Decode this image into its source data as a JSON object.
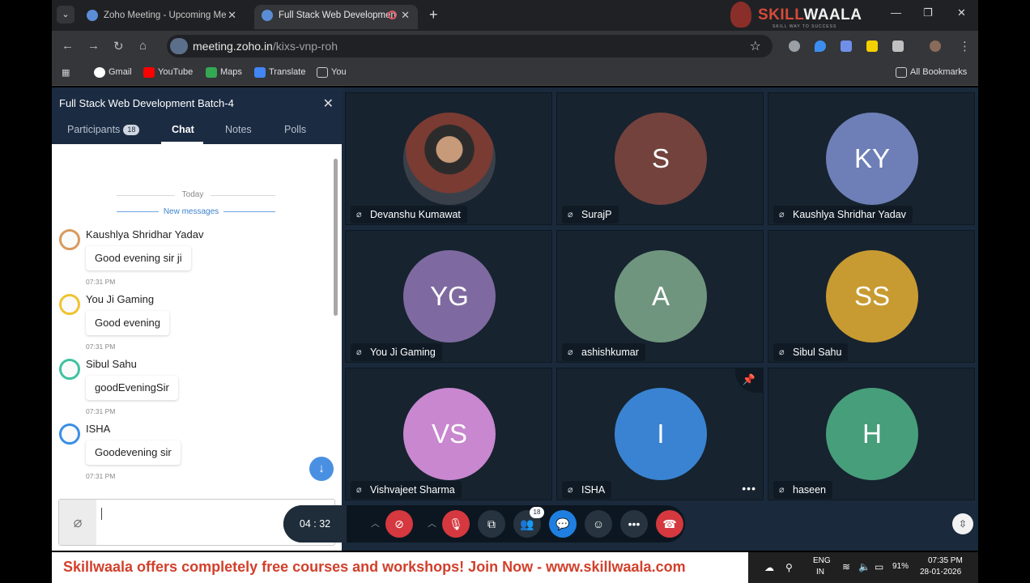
{
  "browser": {
    "tabs": [
      {
        "title": "Zoho Meeting - Upcoming Me",
        "active": false
      },
      {
        "title": "Full Stack Web Developmen",
        "active": true
      }
    ],
    "url_host": "meeting.zoho.in",
    "url_path": "/kixs-vnp-roh",
    "bookmarks": [
      "Gmail",
      "YouTube",
      "Maps",
      "Translate",
      "You"
    ],
    "all_bookmarks": "All Bookmarks",
    "brand": "SKILLWAALA"
  },
  "panel": {
    "title": "Full Stack Web Development Batch-4",
    "tabs": [
      "Participants",
      "Chat",
      "Notes",
      "Polls"
    ],
    "participant_count": "18",
    "active_tab": "Chat"
  },
  "chat": {
    "today_label": "Today",
    "new_messages_label": "New messages",
    "messages": [
      {
        "sender": "Kaushlya Shridhar Yadav",
        "text": "Good evening sir ji",
        "time": "07:31 PM",
        "color": "#d89a5c"
      },
      {
        "sender": "You Ji Gaming",
        "text": "Good evening",
        "time": "07:31 PM",
        "color": "#f0c330"
      },
      {
        "sender": "Sibul Sahu",
        "text": "goodEveningSir",
        "time": "07:31 PM",
        "color": "#3fc2a2"
      },
      {
        "sender": "ISHA",
        "text": "Goodevening sir",
        "time": "07:31 PM",
        "color": "#3a8ee6"
      }
    ]
  },
  "participants": [
    {
      "name": "Devanshu Kumawat",
      "initials": "",
      "color": "#555555",
      "photo": true
    },
    {
      "name": "SurajP",
      "initials": "S",
      "color": "#73423c"
    },
    {
      "name": "Kaushlya Shridhar Yadav",
      "initials": "KY",
      "color": "#6d7fb6"
    },
    {
      "name": "You Ji Gaming",
      "initials": "YG",
      "color": "#7e6aa0"
    },
    {
      "name": "ashishkumar",
      "initials": "A",
      "color": "#6f957f"
    },
    {
      "name": "Sibul Sahu",
      "initials": "SS",
      "color": "#c89b32"
    },
    {
      "name": "Vishvajeet Sharma",
      "initials": "VS",
      "color": "#c887cf"
    },
    {
      "name": "ISHA",
      "initials": "I",
      "color": "#3a83d2"
    },
    {
      "name": "haseen",
      "initials": "H",
      "color": "#479e7b"
    }
  ],
  "controls": {
    "timer": "04 : 32",
    "participant_badge": "18"
  },
  "banner": {
    "text": "Skillwaala offers completely free courses and workshops! Join Now - www.skillwaala.com"
  },
  "taskbar": {
    "lang_line1": "ENG",
    "lang_line2": "IN",
    "battery": "91%",
    "time": "07:35 PM",
    "date": "28-01-2026"
  }
}
